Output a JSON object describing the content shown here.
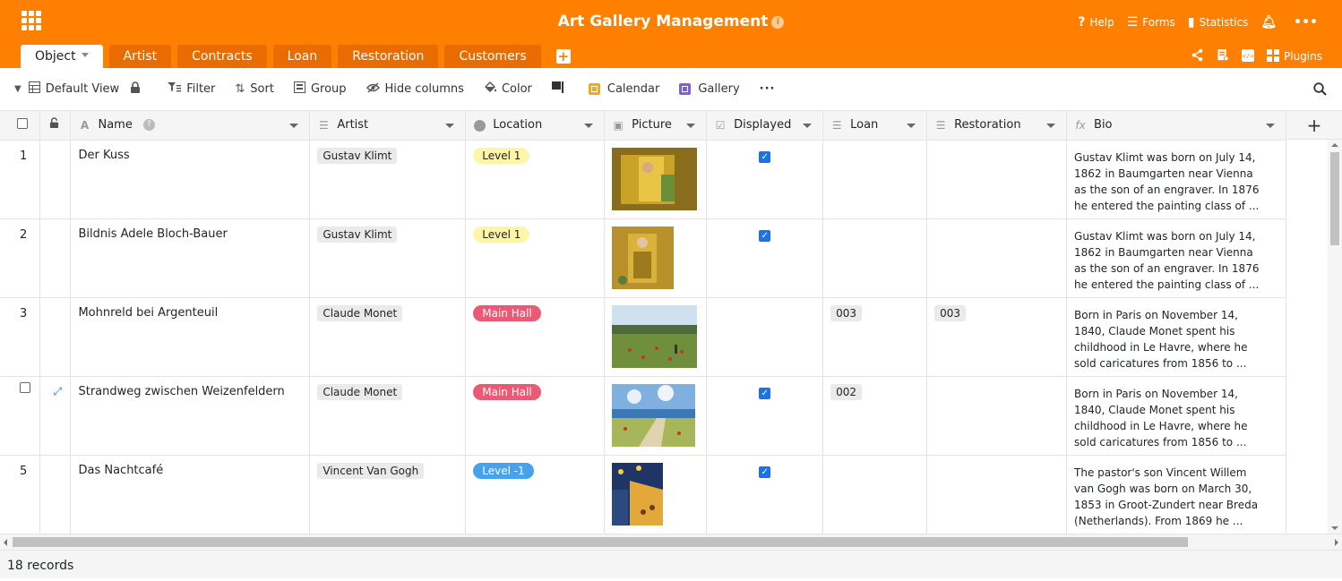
{
  "app": {
    "title": "Art Gallery Management",
    "info_icon": "info-icon"
  },
  "topright": [
    {
      "label": "Help",
      "icon": "help-icon"
    },
    {
      "label": "Forms",
      "icon": "forms-icon"
    },
    {
      "label": "Statistics",
      "icon": "statistics-icon"
    }
  ],
  "tabs": [
    "Object",
    "Artist",
    "Contracts",
    "Loan",
    "Restoration",
    "Customers"
  ],
  "tab_actions": {
    "plugins": "Plugins"
  },
  "toolbar": {
    "view": "Default View",
    "filter": "Filter",
    "sort": "Sort",
    "group": "Group",
    "hide_columns": "Hide columns",
    "color": "Color",
    "calendar": "Calendar",
    "gallery": "Gallery"
  },
  "columns": [
    "Name",
    "Artist",
    "Location",
    "Picture",
    "Displayed",
    "Loan",
    "Restoration",
    "Bio"
  ],
  "rows": [
    {
      "num": "1",
      "name": "Der Kuss",
      "artist": "Gustav Klimt",
      "location": "Level 1",
      "loc_color": "#fff5a8",
      "loc_text": "#212529",
      "displayed": true,
      "loan": "",
      "restoration": "",
      "bio": [
        "Gustav Klimt was born on July 14,",
        "1862 in Baumgarten near Vienna",
        "as the son of an engraver. In 1876",
        "he entered the painting class of ..."
      ]
    },
    {
      "num": "2",
      "name": "Bildnis Adele Bloch-Bauer",
      "artist": "Gustav Klimt",
      "location": "Level 1",
      "loc_color": "#fff5a8",
      "loc_text": "#212529",
      "displayed": true,
      "loan": "",
      "restoration": "",
      "bio": [
        "Gustav Klimt was born on July 14,",
        "1862 in Baumgarten near Vienna",
        "as the son of an engraver. In 1876",
        "he entered the painting class of ..."
      ]
    },
    {
      "num": "3",
      "name": "Mohnreld bei Argenteuil",
      "artist": "Claude Monet",
      "location": "Main Hall",
      "loc_color": "#eb5a74",
      "loc_text": "#ffffff",
      "displayed": false,
      "loan": "003",
      "restoration": "003",
      "bio": [
        "Born in Paris on November 14,",
        "1840, Claude Monet spent his",
        "childhood in Le Havre, where he",
        "sold caricatures from 1856 to ..."
      ]
    },
    {
      "num": "",
      "name": "Strandweg zwischen Weizenfeldern",
      "artist": "Claude Monet",
      "location": "Main Hall",
      "loc_color": "#eb5a74",
      "loc_text": "#ffffff",
      "displayed": true,
      "loan": "002",
      "restoration": "",
      "bio": [
        "Born in Paris on November 14,",
        "1840, Claude Monet spent his",
        "childhood in Le Havre, where he",
        "sold caricatures from 1856 to ..."
      ]
    },
    {
      "num": "5",
      "name": "Das Nachtcafé",
      "artist": "Vincent Van Gogh",
      "location": "Level -1",
      "loc_color": "#46a1ee",
      "loc_text": "#ffffff",
      "displayed": true,
      "loan": "",
      "restoration": "",
      "bio": [
        "The pastor's son Vincent Willem",
        "van Gogh was born on March 30,",
        "1853 in Groot-Zundert near Breda",
        "(Netherlands). From 1869 he ..."
      ]
    }
  ],
  "footer": {
    "records": "18 records"
  },
  "colors": {
    "brand": "#ff8000",
    "tab_bg": "#e96c00",
    "checkbox": "#1a73e8"
  }
}
